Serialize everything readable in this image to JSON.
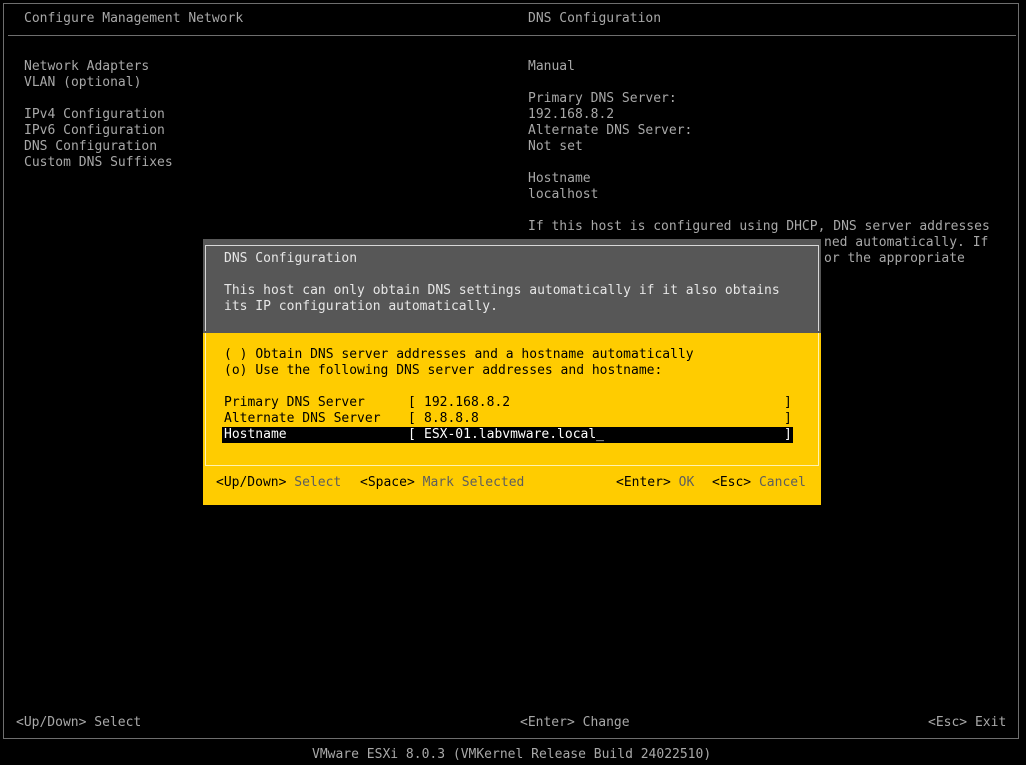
{
  "left_panel": {
    "title": "Configure Management Network",
    "items": [
      {
        "label": "Network Adapters"
      },
      {
        "label": "VLAN (optional)"
      },
      {
        "label": "IPv4 Configuration"
      },
      {
        "label": "IPv6 Configuration"
      },
      {
        "label": "DNS Configuration"
      },
      {
        "label": "Custom DNS Suffixes"
      }
    ]
  },
  "right_panel": {
    "title": "DNS Configuration",
    "mode": "Manual",
    "primary_label": "Primary DNS Server:",
    "primary_value": "192.168.8.2",
    "alternate_label": "Alternate DNS Server:",
    "alternate_value": "Not set",
    "hostname_label": "Hostname",
    "hostname_value": "localhost",
    "help_lines": [
      "If this host is configured using DHCP, DNS server addresses",
      "ned automatically. If",
      "or the appropriate"
    ]
  },
  "dialog": {
    "title": "DNS Configuration",
    "description_lines": [
      "This host can only obtain DNS settings automatically if it also obtains",
      "its IP configuration automatically."
    ],
    "options": [
      {
        "marker": "( )",
        "label": "Obtain DNS server addresses and a hostname automatically"
      },
      {
        "marker": "(o)",
        "label": "Use the following DNS server addresses and hostname:"
      }
    ],
    "fields": {
      "primary": {
        "label": "Primary DNS Server",
        "value": "192.168.8.2"
      },
      "alternate": {
        "label": "Alternate DNS Server",
        "value": "8.8.8.8"
      },
      "hostname": {
        "label": "Hostname",
        "value": "ESX-01.labvmware.local_"
      }
    },
    "open_bracket": "[",
    "close_bracket": "]",
    "hints": {
      "updown_key": "<Up/Down>",
      "updown_action": "Select",
      "space_key": "<Space>",
      "space_action": "Mark Selected",
      "enter_key": "<Enter>",
      "enter_action": "OK",
      "esc_key": "<Esc>",
      "esc_action": "Cancel"
    }
  },
  "bottom_hints": {
    "updown": "<Up/Down> Select",
    "enter": "<Enter> Change",
    "esc": "<Esc> Exit"
  },
  "footer": "VMware ESXi 8.0.3 (VMKernel Release Build 24022510)",
  "colors": {
    "background": "#000000",
    "text": "#a8a8a8",
    "dialog_header": "#575757",
    "dialog_body": "#ffcc00"
  }
}
